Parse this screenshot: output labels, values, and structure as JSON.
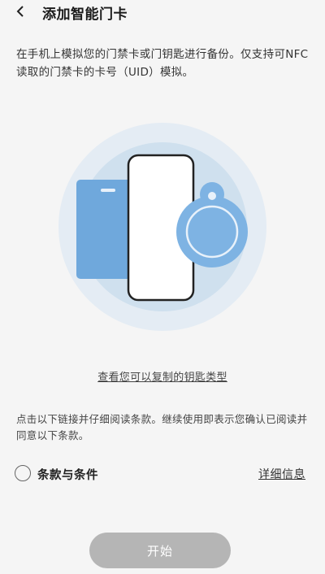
{
  "header": {
    "back_icon": "chevron-left-icon",
    "title": "添加智能门卡"
  },
  "description": "在手机上模拟您的门禁卡或门钥匙进行备份。仅支持可NFC读取的门禁卡的卡号（UID）模拟。",
  "illustration": {
    "icons": [
      "access-card-icon",
      "phone-icon",
      "key-fob-icon"
    ],
    "colors": {
      "halo_outer": "#e4ecf4",
      "halo_inner": "#cfe0ee",
      "card": "#6fa8dc",
      "fob": "#7eb3e3",
      "phone_outline": "#222222"
    }
  },
  "key_types_link": "查看您可以复制的钥匙类型",
  "terms_note": "点击以下链接并仔细阅读条款。继续使用即表示您确认已阅读并同意以下条款。",
  "terms": {
    "checkbox_checked": false,
    "label": "条款与条件",
    "details_link": "详细信息"
  },
  "start_button": {
    "label": "开始",
    "enabled": false,
    "color": "#b5b5b5"
  }
}
